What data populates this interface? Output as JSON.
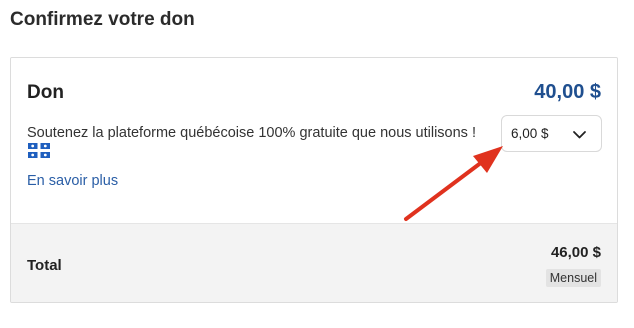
{
  "page": {
    "title": "Confirmez votre don"
  },
  "donation": {
    "title": "Don",
    "amount": "40,00 $",
    "description": "Soutenez la plateforme québécoise 100% gratuite que nous utilisons !",
    "flag_icon": "quebec-flag-icon",
    "learn_more": "En savoir plus",
    "tip_select": {
      "value": "6,00 $",
      "icon": "chevron-down-icon"
    }
  },
  "summary": {
    "total_label": "Total",
    "total_amount": "46,00 $",
    "frequency": "Mensuel"
  },
  "annotation": {
    "arrow_icon": "red-arrow-icon",
    "arrow_color": "#e0321e"
  },
  "colors": {
    "amount": "#1f4f8f",
    "link": "#2a5ea6",
    "summary_bg": "#f3f3f3"
  }
}
